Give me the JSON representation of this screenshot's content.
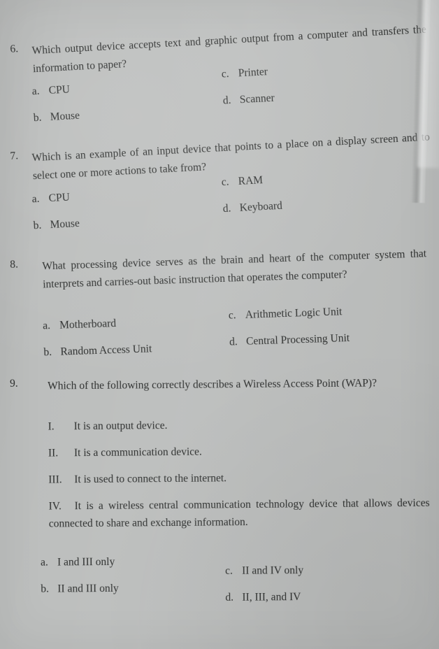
{
  "document": {
    "type": "exam-worksheet-page",
    "background_color": "#bcbebd",
    "text_color": "#2b2d2c"
  },
  "questions": [
    {
      "number": "6.",
      "stem": "Which output device accepts text and graphic output from a computer and transfers the information to paper?",
      "options": [
        {
          "label": "a.",
          "text": "CPU"
        },
        {
          "label": "b.",
          "text": "Mouse"
        },
        {
          "label": "c.",
          "text": "Printer"
        },
        {
          "label": "d.",
          "text": "Scanner"
        }
      ]
    },
    {
      "number": "7.",
      "stem": "Which is an example of an input device that points to a place on a display screen and to select one or more actions to take from?",
      "options": [
        {
          "label": "a.",
          "text": "CPU"
        },
        {
          "label": "b.",
          "text": "Mouse"
        },
        {
          "label": "c.",
          "text": "RAM"
        },
        {
          "label": "d.",
          "text": "Keyboard"
        }
      ]
    },
    {
      "number": "8.",
      "stem": "What processing device serves as the brain and heart of the computer system that interprets and carries-out basic instruction that operates the computer?",
      "options": [
        {
          "label": "a.",
          "text": "Motherboard"
        },
        {
          "label": "b.",
          "text": "Random Access Unit"
        },
        {
          "label": "c.",
          "text": "Arithmetic Logic Unit"
        },
        {
          "label": "d.",
          "text": "Central Processing Unit"
        }
      ]
    },
    {
      "number": "9.",
      "stem": "Which of the following correctly describes a Wireless Access Point (WAP)?",
      "statements": [
        {
          "label": "I.",
          "text": "It is an output device."
        },
        {
          "label": "II.",
          "text": "It is a communication device."
        },
        {
          "label": "III.",
          "text": "It is used to connect to the internet."
        },
        {
          "label": "IV.",
          "text": "It is a wireless central communication technology device that allows devices connected to share and exchange information."
        }
      ],
      "options": [
        {
          "label": "a.",
          "text": "I and III only"
        },
        {
          "label": "b.",
          "text": "II and III only"
        },
        {
          "label": "c.",
          "text": "II and IV only"
        },
        {
          "label": "d.",
          "text": "II, III, and IV"
        }
      ]
    }
  ]
}
